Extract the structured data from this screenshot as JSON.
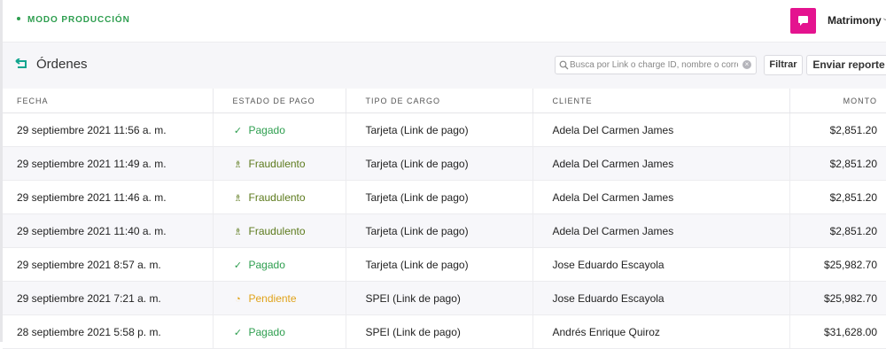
{
  "topbar": {
    "mode_label": "MODO PRODUCCIÓN",
    "account_name": "Matrimony"
  },
  "page": {
    "title": "Órdenes",
    "search_placeholder": "Busca por Link o charge ID, nombre o correo",
    "filter_label": "Filtrar",
    "report_label": "Enviar reporte"
  },
  "table": {
    "headers": [
      "FECHA",
      "ESTADO DE PAGO",
      "TIPO DE CARGO",
      "CLIENTE",
      "MONTO"
    ],
    "rows": [
      {
        "date": "29 septiembre 2021 11:56 a. m.",
        "status": "Pagado",
        "status_icon": "check-icon",
        "type": "Tarjeta (Link de pago)",
        "client": "Adela Del Carmen James",
        "amount": "$2,851.20"
      },
      {
        "date": "29 septiembre 2021 11:49 a. m.",
        "status": "Fraudulento",
        "status_icon": "fraud-icon",
        "type": "Tarjeta (Link de pago)",
        "client": "Adela Del Carmen James",
        "amount": "$2,851.20"
      },
      {
        "date": "29 septiembre 2021 11:46 a. m.",
        "status": "Fraudulento",
        "status_icon": "fraud-icon",
        "type": "Tarjeta (Link de pago)",
        "client": "Adela Del Carmen James",
        "amount": "$2,851.20"
      },
      {
        "date": "29 septiembre 2021 11:40 a. m.",
        "status": "Fraudulento",
        "status_icon": "fraud-icon",
        "type": "Tarjeta (Link de pago)",
        "client": "Adela Del Carmen James",
        "amount": "$2,851.20"
      },
      {
        "date": "29 septiembre 2021 8:57 a. m.",
        "status": "Pagado",
        "status_icon": "check-icon",
        "type": "Tarjeta (Link de pago)",
        "client": "Jose Eduardo Escayola",
        "amount": "$25,982.70"
      },
      {
        "date": "29 septiembre 2021 7:21 a. m.",
        "status": "Pendiente",
        "status_icon": "clock-icon",
        "type": "SPEI (Link de pago)",
        "client": "Jose Eduardo Escayola",
        "amount": "$25,982.70"
      },
      {
        "date": "28 septiembre 2021 5:58 p. m.",
        "status": "Pagado",
        "status_icon": "check-icon",
        "type": "SPEI (Link de pago)",
        "client": "Andrés Enrique Quiroz",
        "amount": "$31,628.00"
      }
    ]
  },
  "colors": {
    "brand_avatar": "#e4138f",
    "production_green": "#2e9e4f",
    "paid": "#2e9e4f",
    "fraud": "#5c7a1c",
    "pending": "#e0a31a"
  }
}
